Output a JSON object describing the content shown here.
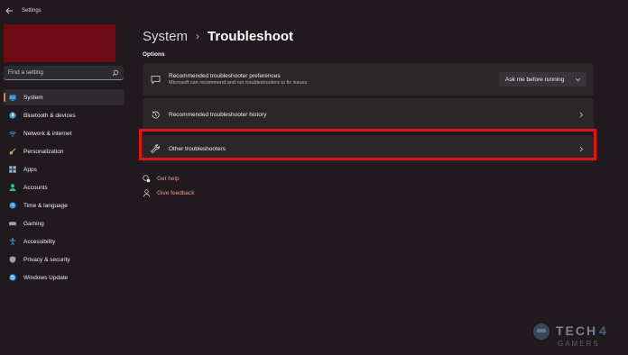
{
  "window": {
    "title": "Settings"
  },
  "search": {
    "placeholder": "Find a setting"
  },
  "sidebar": {
    "items": [
      {
        "label": "System",
        "icon": "system-icon",
        "color": "#3aa0e8",
        "active": true
      },
      {
        "label": "Bluetooth & devices",
        "icon": "bluetooth-icon",
        "color": "#3aa0e8"
      },
      {
        "label": "Network & internet",
        "icon": "wifi-icon",
        "color": "#3aa0e8"
      },
      {
        "label": "Personalization",
        "icon": "brush-icon",
        "color": "#e0a060"
      },
      {
        "label": "Apps",
        "icon": "apps-icon",
        "color": "#9ab4d8"
      },
      {
        "label": "Accounts",
        "icon": "person-icon",
        "color": "#2ec58a"
      },
      {
        "label": "Time & language",
        "icon": "globe-clock-icon",
        "color": "#3aa0e8"
      },
      {
        "label": "Gaming",
        "icon": "gamepad-icon",
        "color": "#9aa4b4"
      },
      {
        "label": "Accessibility",
        "icon": "accessibility-icon",
        "color": "#3aa0e8"
      },
      {
        "label": "Privacy & security",
        "icon": "shield-icon",
        "color": "#9aa4b4"
      },
      {
        "label": "Windows Update",
        "icon": "update-icon",
        "color": "#3aa0e8"
      }
    ]
  },
  "breadcrumb": {
    "parent": "System",
    "separator": "›",
    "current": "Troubleshoot"
  },
  "options": {
    "section_title": "Options",
    "cards": [
      {
        "title": "Recommended troubleshooter preferences",
        "subtitle": "Microsoft can recommend and run troubleshooters to fix issues",
        "icon": "message-check-icon",
        "dropdown_value": "Ask me before running"
      },
      {
        "title": "Recommended troubleshooter history",
        "icon": "history-icon"
      },
      {
        "title": "Other troubleshooters",
        "icon": "wrench-icon",
        "highlighted": true
      }
    ]
  },
  "links": {
    "get_help": "Get help",
    "give_feedback": "Give feedback"
  },
  "colors": {
    "accent": "#e8785e",
    "highlight_border": "#e3111c",
    "link": "#e99a84",
    "profile_banner": "#6e0b14"
  }
}
